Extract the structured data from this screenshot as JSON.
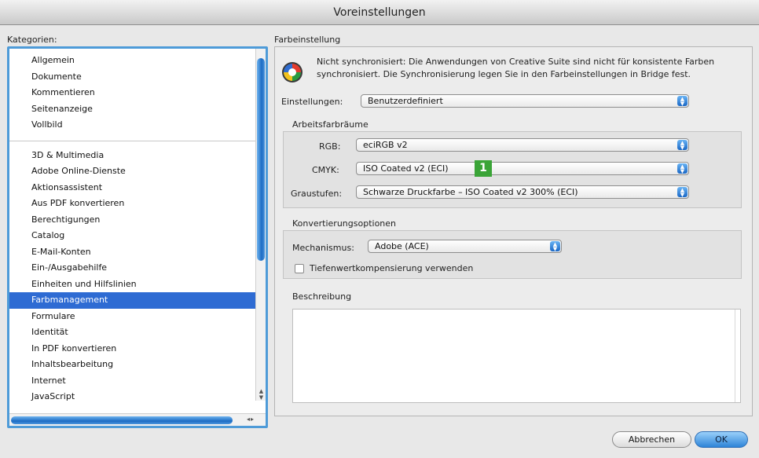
{
  "window": {
    "title": "Voreinstellungen"
  },
  "categories": {
    "label": "Kategorien:",
    "top_items": [
      "Allgemein",
      "Dokumente",
      "Kommentieren",
      "Seitenanzeige",
      "Vollbild"
    ],
    "items": [
      "3D & Multimedia",
      "Adobe Online-Dienste",
      "Aktionsassistent",
      "Aus PDF konvertieren",
      "Berechtigungen",
      "Catalog",
      "E-Mail-Konten",
      "Ein-/Ausgabehilfe",
      "Einheiten und Hilfslinien",
      "Farbmanagement",
      "Formulare",
      "Identität",
      "In PDF konvertieren",
      "Inhaltsbearbeitung",
      "Internet",
      "JavaScript"
    ],
    "selected": "Farbmanagement"
  },
  "farbeinstellung": {
    "label": "Farbeinstellung",
    "sync_message": "Nicht synchronisiert: Die Anwendungen von Creative Suite sind nicht für konsistente Farben synchronisiert. Die Synchronisierung legen Sie in den Farbeinstellungen in Bridge fest.",
    "settings_label": "Einstellungen:",
    "settings_value": "Benutzerdefiniert"
  },
  "arbeitsfarbraeume": {
    "title": "Arbeitsfarbräume",
    "rgb_label": "RGB:",
    "rgb_value": "eciRGB v2",
    "cmyk_label": "CMYK:",
    "cmyk_value": "ISO Coated v2 (ECI)",
    "gray_label": "Graustufen:",
    "gray_value": "Schwarze Druckfarbe – ISO Coated v2 300% (ECI)"
  },
  "annotation": {
    "badge": "1",
    "color": "#3aa437"
  },
  "konvertierung": {
    "title": "Konvertierungsoptionen",
    "mechanism_label": "Mechanismus:",
    "mechanism_value": "Adobe (ACE)",
    "checkbox_label": "Tiefenwertkompensierung verwenden",
    "checkbox_checked": false
  },
  "beschreibung": {
    "title": "Beschreibung"
  },
  "buttons": {
    "cancel": "Abbrechen",
    "ok": "OK"
  }
}
